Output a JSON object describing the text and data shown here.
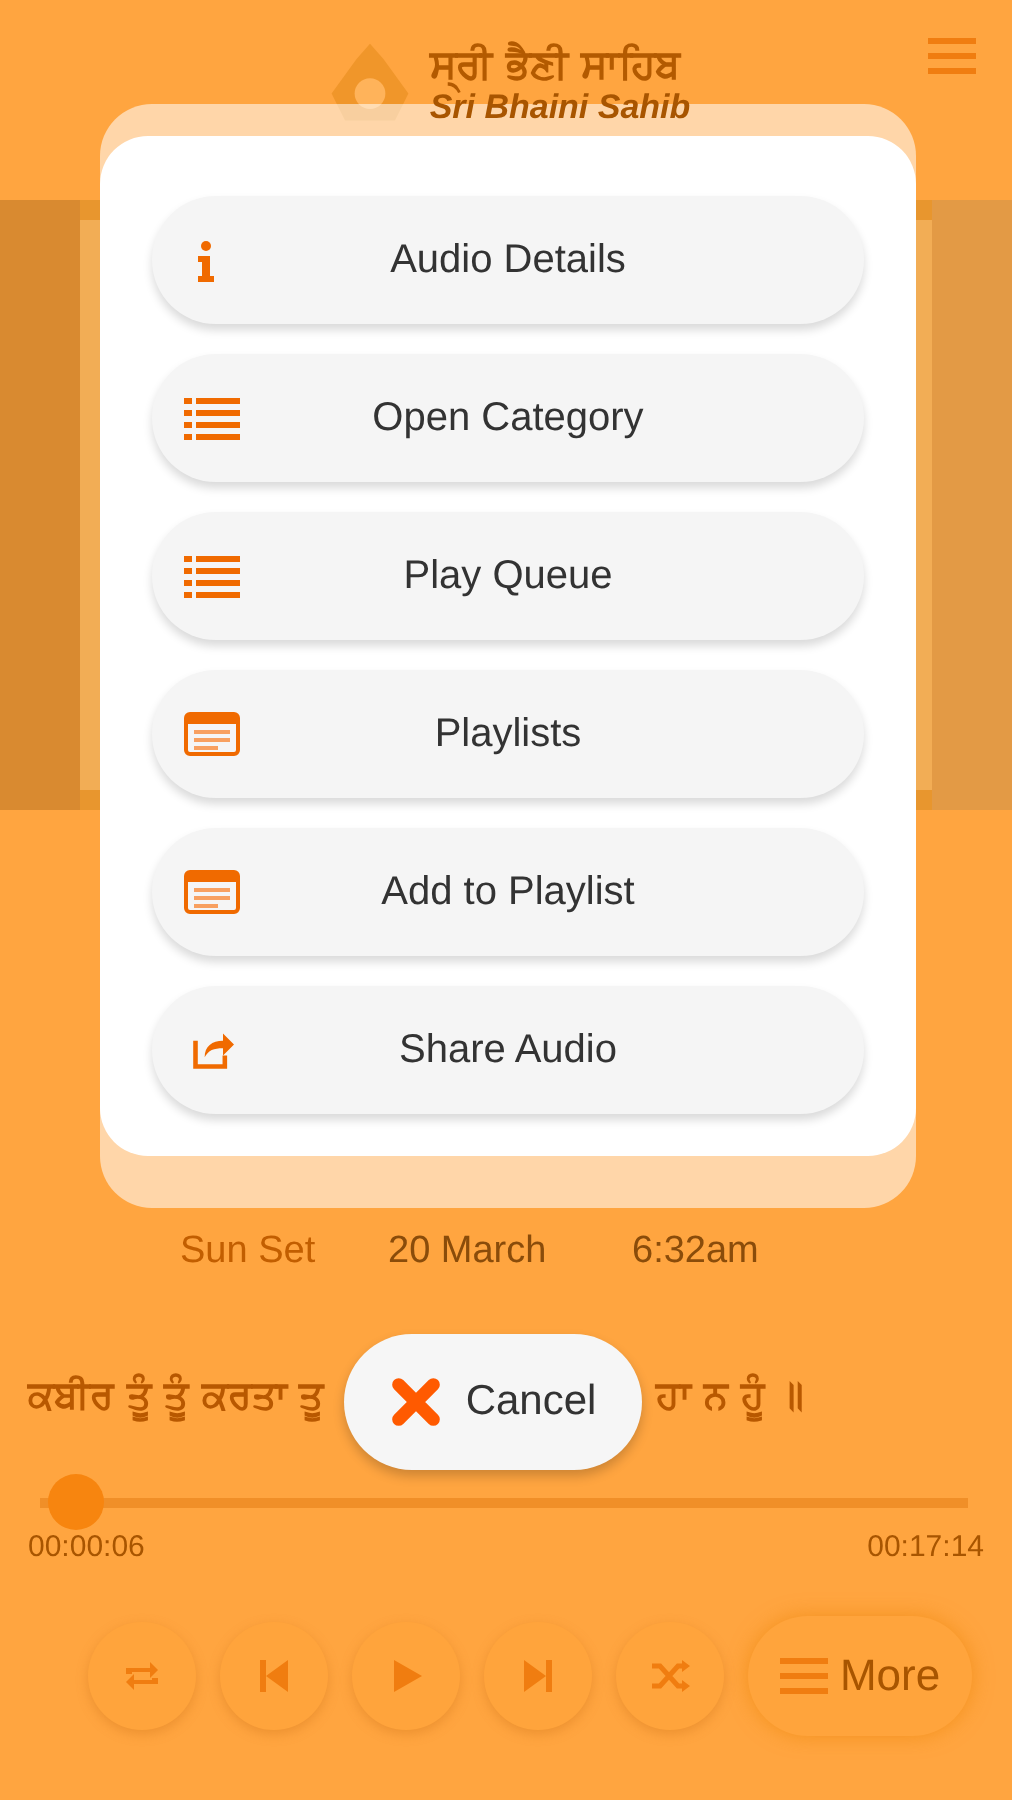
{
  "header": {
    "title_gurmukhi": "ਸ੍ਰੀ ਭੈਣੀ ਸਾਹਿਬ",
    "title_latin": "Sri Bhaini Sahib"
  },
  "sun_times": [
    {
      "label": "Sun Set",
      "date": "20 March",
      "time": "6:32am"
    }
  ],
  "now_playing": {
    "line_parts": [
      "ਕਬੀਰ ਤੂੰ ਤੂੰ ਕਰਤਾ ਤੂ",
      "ਹਾ ਨ ਹੂੰ ॥"
    ],
    "level": 0.01,
    "elapsed": "00:00:06",
    "total": "00:17:14"
  },
  "controls": [
    {
      "kind": "repeat"
    },
    {
      "kind": "previous"
    },
    {
      "kind": "play"
    },
    {
      "kind": "next"
    },
    {
      "kind": "shuffle"
    },
    {
      "kind": "more",
      "label": "More"
    }
  ],
  "menu": {
    "items": [
      {
        "kind": "info",
        "label": "Audio Details"
      },
      {
        "kind": "list",
        "label": "Open Category"
      },
      {
        "kind": "list",
        "label": "Play Queue"
      },
      {
        "kind": "card",
        "label": "Playlists"
      },
      {
        "kind": "card",
        "label": "Add to Playlist"
      },
      {
        "kind": "share",
        "label": "Share Audio"
      }
    ],
    "cancel": "Cancel"
  }
}
